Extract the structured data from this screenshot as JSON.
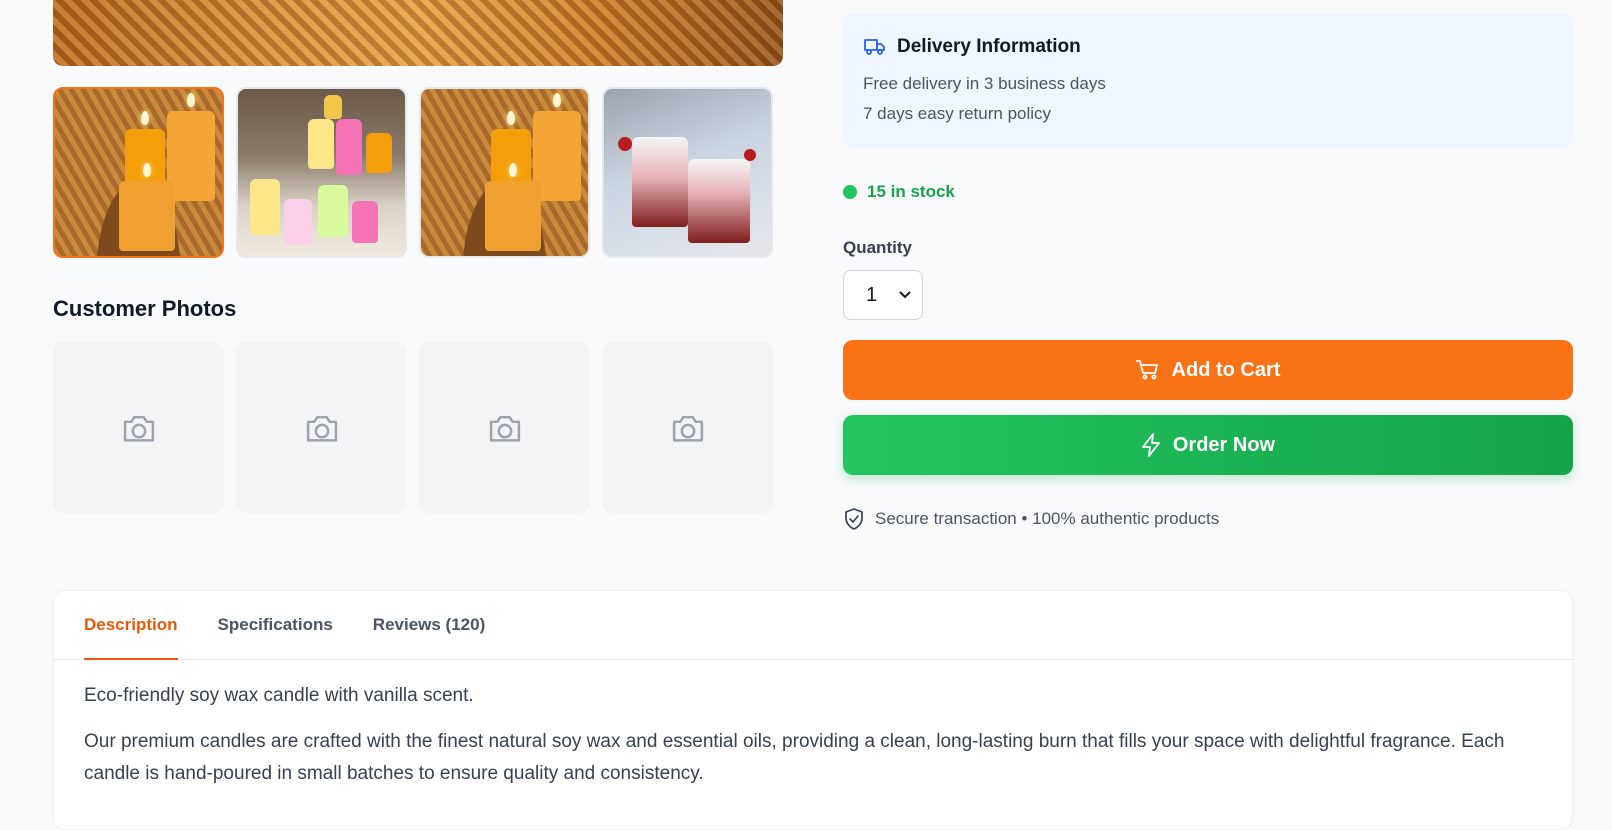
{
  "gallery": {
    "thumbnails": [
      "orange honeycomb candles",
      "assorted floral candles",
      "orange honeycomb candles",
      "red ombre candles"
    ],
    "active_index": 0
  },
  "customer_photos": {
    "title": "Customer Photos",
    "count": 4,
    "icon": "camera-icon"
  },
  "delivery": {
    "icon": "truck-icon",
    "title": "Delivery Information",
    "line1": "Free delivery in 3 business days",
    "line2": "7 days easy return policy"
  },
  "stock": {
    "text": "15 in stock",
    "color": "#22c55e"
  },
  "quantity": {
    "label": "Quantity",
    "value": "1"
  },
  "actions": {
    "add_to_cart": "Add to Cart",
    "order_now": "Order Now",
    "cart_color": "#f97316",
    "order_color": "#22c55e"
  },
  "secure": {
    "icon": "shield-check-icon",
    "text": "Secure transaction • 100% authentic products"
  },
  "tabs": [
    {
      "label": "Description",
      "active": true
    },
    {
      "label": "Specifications",
      "active": false
    },
    {
      "label": "Reviews (120)",
      "active": false
    }
  ],
  "description": {
    "p1": "Eco-friendly soy wax candle with vanilla scent.",
    "p2": "Our premium candles are crafted with the finest natural soy wax and essential oils, providing a clean, long-lasting burn that fills your space with delightful fragrance. Each candle is hand-poured in small batches to ensure quality and consistency."
  }
}
